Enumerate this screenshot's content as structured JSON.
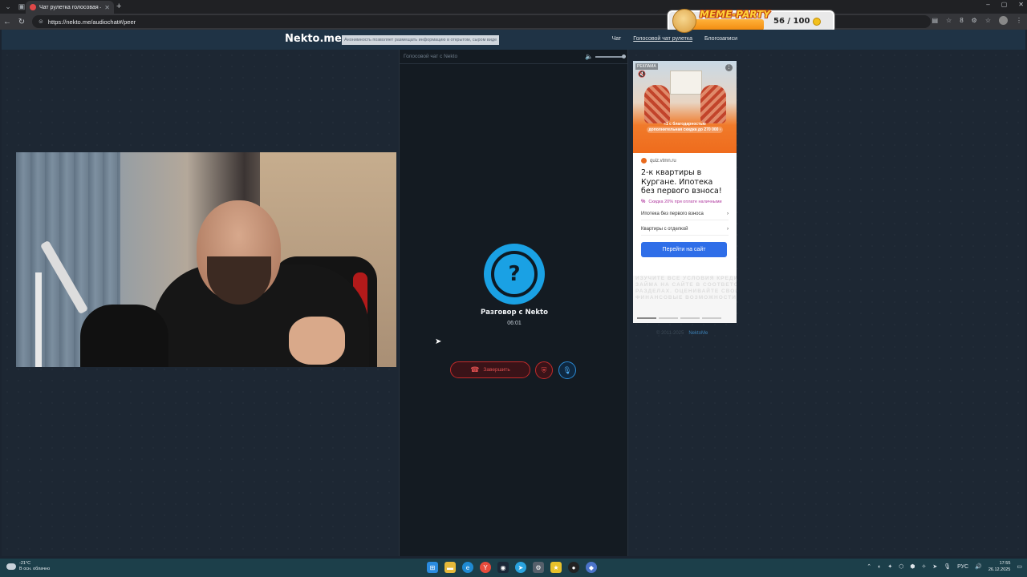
{
  "browser": {
    "tab_title": "Чат рулетка голосовая — N",
    "url": "https://nekto.me/audiochat#/peer",
    "new_tab_icon": "plus-icon",
    "window_controls": [
      "–",
      "▢",
      "✕"
    ],
    "extension_count": "8"
  },
  "overlay": {
    "title": "MEME-PARTY",
    "count": "56 / 100"
  },
  "site": {
    "logo": "Nekto.me",
    "notice": "Анонимность позволяет размещать информацию в открытом, сыром виде",
    "nav": [
      {
        "label": "Чат"
      },
      {
        "label": "Голосовой чат рулетка"
      },
      {
        "label": "Блогозаписи"
      }
    ]
  },
  "chat": {
    "header": "Голосовой чат с Nekto",
    "avatar_symbol": "?",
    "talk_title": "Разговор с Nekto",
    "timer": "06:01",
    "end_button": "Завершить",
    "block_icon": "shield-icon",
    "mic_icon": "microphone-icon",
    "volume_level": 1.0
  },
  "ad": {
    "label": "РЕКЛАМА",
    "promo_line1": "«1 с благодарностью",
    "promo_line2": "дополнительная скидка до 270 000 ›",
    "source": "quiz.vtmn.ru",
    "title": "2-к квартиры в Кургане. Ипотека без первого взноса!",
    "discount": "Скидка 20% при оплате наличными",
    "items": [
      {
        "label": "Ипотека без первого взноса"
      },
      {
        "label": "Квартиры с отделкой"
      }
    ],
    "button": "Перейти на сайт",
    "fine_lines": [
      "ИЗУЧИТЕ ВСЕ УСЛОВИЯ КРЕДИТА",
      "ЗАЙМА НА САЙТЕ В СООТВЕТСТВУЮЩИХ",
      "РАЗДЕЛАХ. ОЦЕНИВАЙТЕ СВОИ",
      "ФИНАНСОВЫЕ ВОЗМОЖНОСТИ И РИСКИ"
    ]
  },
  "footer": {
    "copyright": "© 2011-2025",
    "link": "NektoMe"
  },
  "taskbar": {
    "temperature": "-21°C",
    "weather": "В осн. облачно",
    "lang": "РУС",
    "time": "17:55",
    "date": "26.12.2025"
  }
}
